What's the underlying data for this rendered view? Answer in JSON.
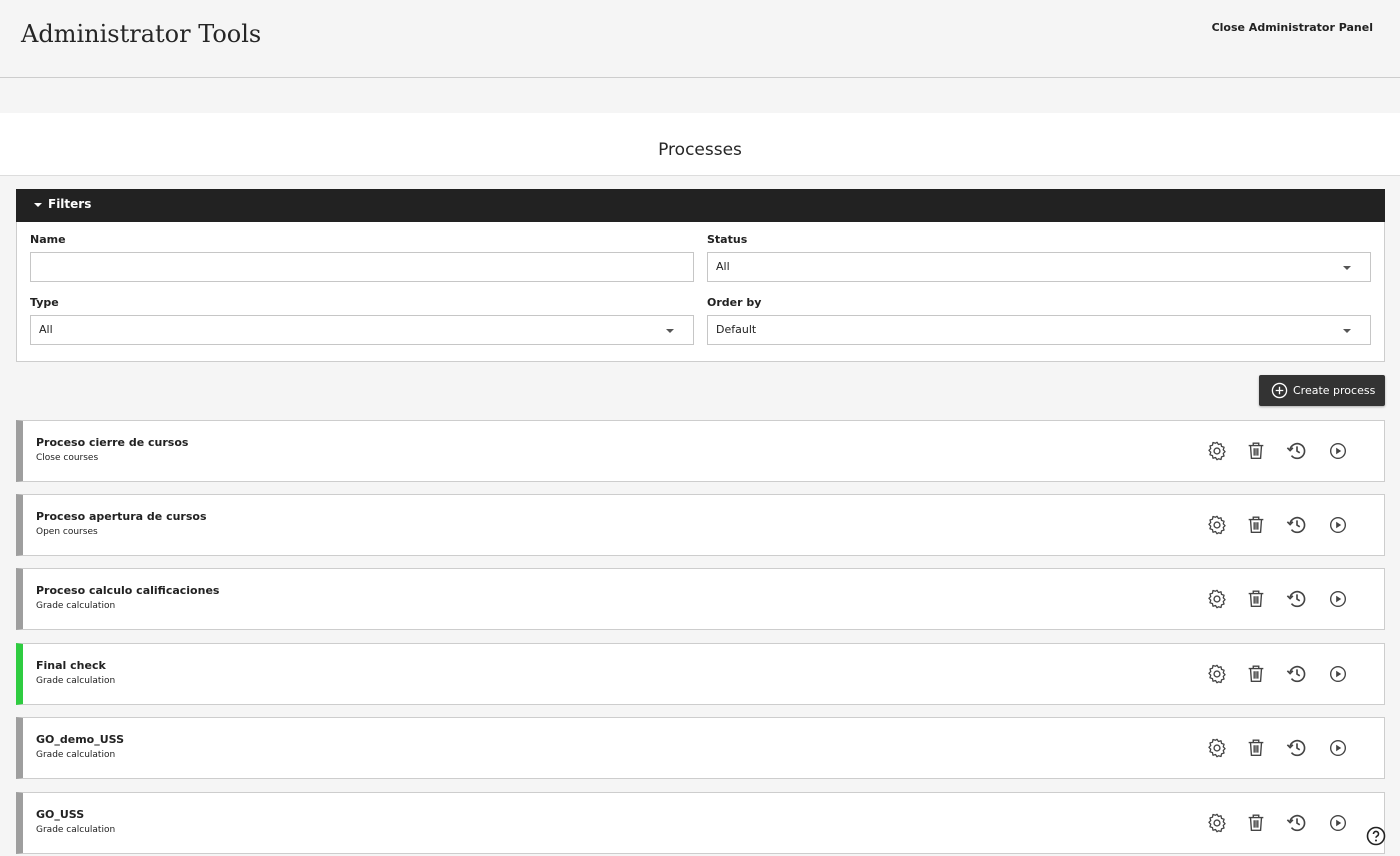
{
  "header": {
    "title": "Administrator Tools",
    "close_label": "Close Administrator Panel"
  },
  "page": {
    "title": "Processes"
  },
  "filters": {
    "label": "Filters",
    "name_label": "Name",
    "name_value": "",
    "status_label": "Status",
    "status_value": "All",
    "type_label": "Type",
    "type_value": "All",
    "order_label": "Order by",
    "order_value": "Default"
  },
  "create_label": "Create process",
  "colors": {
    "inactive": "#9e9e9e",
    "active": "#2ecc40"
  },
  "processes": [
    {
      "name": "Proceso cierre de cursos",
      "type": "Close courses",
      "active": false
    },
    {
      "name": "Proceso apertura de cursos",
      "type": "Open courses",
      "active": false
    },
    {
      "name": "Proceso calculo calificaciones",
      "type": "Grade calculation",
      "active": false
    },
    {
      "name": "Final check",
      "type": "Grade calculation",
      "active": true
    },
    {
      "name": "GO_demo_USS",
      "type": "Grade calculation",
      "active": false
    },
    {
      "name": "GO_USS",
      "type": "Grade calculation",
      "active": false
    }
  ]
}
